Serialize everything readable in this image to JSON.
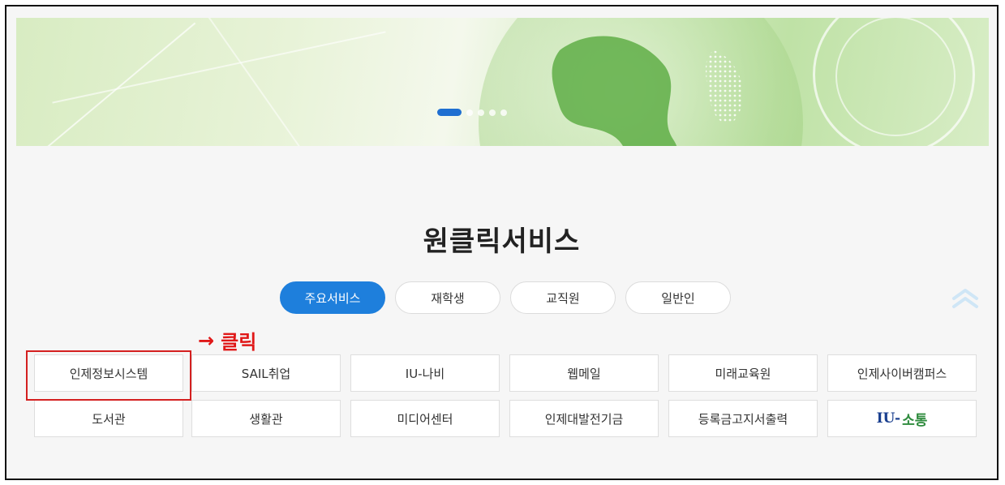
{
  "banner": {
    "pager_active_index": 1
  },
  "section": {
    "title": "원클릭서비스"
  },
  "tabs": [
    {
      "label": "주요서비스",
      "active": true
    },
    {
      "label": "재학생",
      "active": false
    },
    {
      "label": "교직원",
      "active": false
    },
    {
      "label": "일반인",
      "active": false
    }
  ],
  "annotation": {
    "arrow": "→",
    "label": "클릭",
    "color": "#e01818"
  },
  "services": {
    "row1": [
      "인제정보시스템",
      "SAIL취업",
      "IU-나비",
      "웹메일",
      "미래교육원",
      "인제사이버캠퍼스"
    ],
    "row2": [
      "도서관",
      "생활관",
      "미디어센터",
      "인제대발전기금",
      "등록금고지서출력",
      "IU-소통"
    ]
  },
  "logo": {
    "latin": "IU-",
    "hangul": "소통"
  },
  "colors": {
    "accent": "#1e7fdc",
    "highlight": "#d42020"
  }
}
